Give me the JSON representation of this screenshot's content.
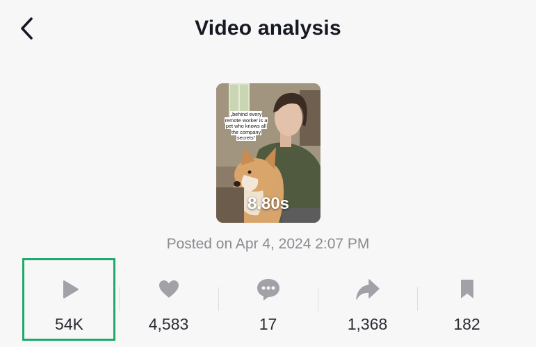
{
  "header": {
    "title": "Video analysis",
    "back_icon": "chevron-left-icon"
  },
  "video": {
    "caption": "„behind every remote worker is a pet who knows all the company secrets“",
    "duration": "8.80s",
    "posted": "Posted on Apr 4, 2024 2:07 PM"
  },
  "stats": [
    {
      "icon": "play-icon",
      "value": "54K"
    },
    {
      "icon": "heart-icon",
      "value": "4,583"
    },
    {
      "icon": "comment-icon",
      "value": "17"
    },
    {
      "icon": "share-icon",
      "value": "1,368"
    },
    {
      "icon": "bookmark-icon",
      "value": "182"
    }
  ],
  "colors": {
    "background": "#f7f7f7",
    "icon_gray": "#a1a2a7",
    "highlight": "#1faa6b",
    "muted_text": "#8a8b91"
  }
}
